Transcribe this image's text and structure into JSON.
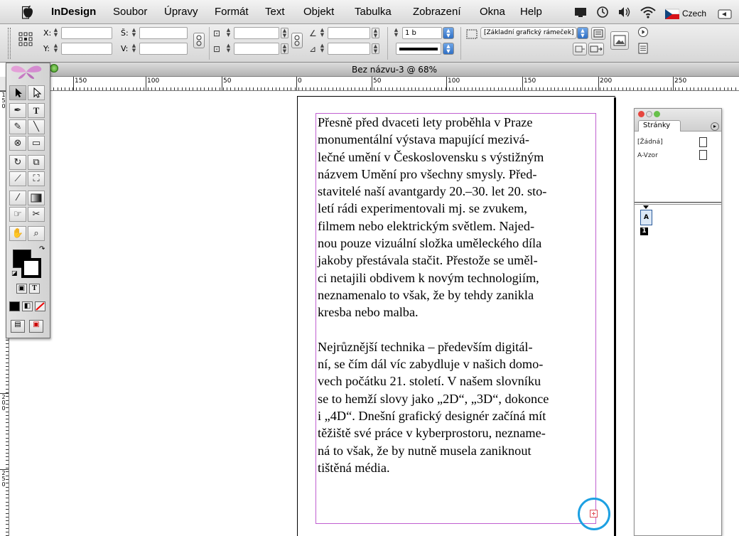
{
  "menubar": {
    "app_name": "InDesign",
    "menus": [
      "Soubor",
      "Úpravy",
      "Formát",
      "Text",
      "Objekt",
      "Tabulka",
      "Zobrazení",
      "Okna",
      "Help"
    ],
    "language": "Czech"
  },
  "control_panel": {
    "x_label": "X:",
    "y_label": "Y:",
    "w_label": "Š:",
    "h_label": "V:",
    "stroke_weight": "1 b",
    "object_style": "[Základní grafický rámeček]"
  },
  "document": {
    "title": "Bez názvu-3 @ 68%"
  },
  "ruler_h": [
    "150",
    "100",
    "50",
    "0",
    "50",
    "100",
    "150",
    "200",
    "250"
  ],
  "ruler_v": [
    "150",
    "200",
    "250"
  ],
  "story": {
    "paragraph1": "Přesně před dvaceti lety proběhla v Praze\nmonumentální výstava mapující mezivá-\nlečné umění v Československu s výstižným\nnázvem Umění pro všechny smysly. Před-\nstavitelé naší avantgardy 20.–30. let 20. sto-\nletí rádi experimentovali mj. se zvukem,\nfilmem nebo elektrickým světlem. Najed-\nnou pouze vizuální složka uměleckého díla\njakoby přestávala stačit. Přestože se uměl-\nci netajili obdivem k novým technologiím,\nneznamenalo to však, že by tehdy zanikla\nkresba nebo malba.",
    "paragraph2": "Nejrůznější technika – především digitál-\nní, se čím dál víc zabydluje v našich domo-\nvech počátku 21. století. V našem slovníku\nse to hemží slovy jako „2D“, „3D“, dokonce\ni „4D“. Dnešní grafický designér začíná mít\ntěžiště své práce v kyberprostoru, nezname-\nná to však, že by nutně musela zaniknout\ntištěná média."
  },
  "pages_panel": {
    "tab_label": "Stránky",
    "masters": [
      "[Žádná]",
      "A-Vzor"
    ],
    "page_prefix": "A",
    "page_number": "1"
  },
  "colors": {
    "text_frame": "#c05fd0",
    "overset_port": "#e0505a",
    "callout_circle": "#1da0e2"
  }
}
